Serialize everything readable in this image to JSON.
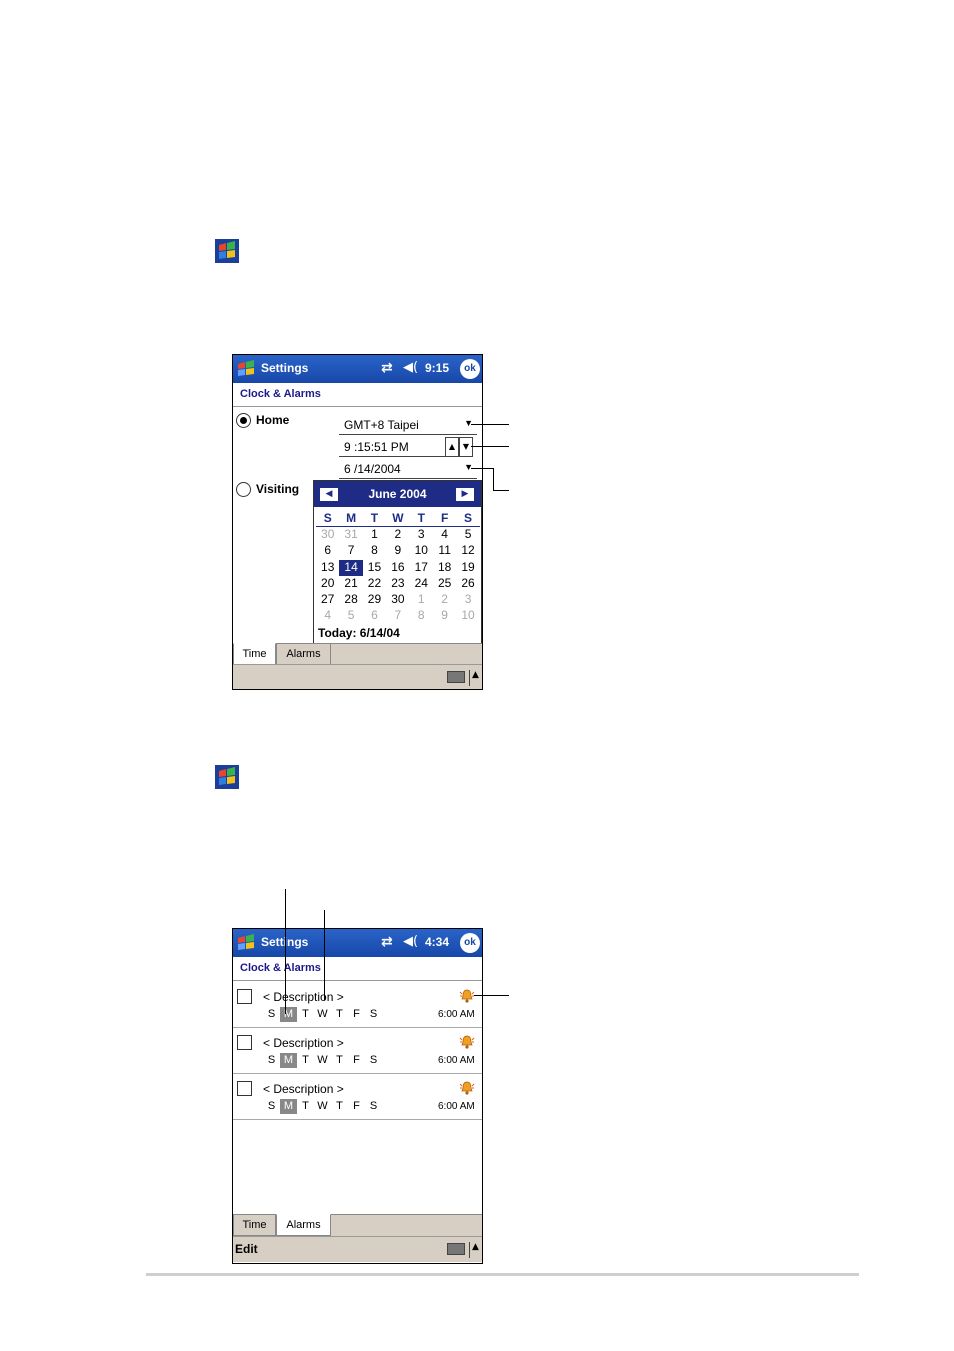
{
  "icon_names": [
    "windows-flag-icon",
    "connectivity-icon",
    "volume-icon",
    "ok-button",
    "keyboard-icon",
    "alarm-bell-icon"
  ],
  "colors": {
    "titlebar": "#1747a8",
    "calendar_header": "#1f2c85",
    "tab_bar": "#d8cfc4"
  },
  "screen1": {
    "titlebar": {
      "title": "Settings",
      "clock": "9:15",
      "ok": "ok",
      "conn_glyph": "⇄",
      "vol_glyph": "◀("
    },
    "app_header": "Clock & Alarms",
    "home_label": "Home",
    "visiting_label": "Visiting",
    "timezone": "GMT+8 Taipei",
    "time": "9 :15:51 PM",
    "date": "6 /14/2004",
    "calendar": {
      "month": "June 2004",
      "weekdays": [
        "S",
        "M",
        "T",
        "W",
        "T",
        "F",
        "S"
      ],
      "weeks": [
        [
          "30",
          "31",
          "1",
          "2",
          "3",
          "4",
          "5"
        ],
        [
          "6",
          "7",
          "8",
          "9",
          "10",
          "11",
          "12"
        ],
        [
          "13",
          "14",
          "15",
          "16",
          "17",
          "18",
          "19"
        ],
        [
          "20",
          "21",
          "22",
          "23",
          "24",
          "25",
          "26"
        ],
        [
          "27",
          "28",
          "29",
          "30",
          "1",
          "2",
          "3"
        ],
        [
          "4",
          "5",
          "6",
          "7",
          "8",
          "9",
          "10"
        ]
      ],
      "selected": "14",
      "today": "Today: 6/14/04"
    },
    "tabs": [
      "Time",
      "Alarms"
    ]
  },
  "screen2": {
    "titlebar": {
      "title": "Settings",
      "clock": "4:34",
      "ok": "ok",
      "conn_glyph": "⇄",
      "vol_glyph": "◀("
    },
    "app_header": "Clock & Alarms",
    "alarms": [
      {
        "description": "< Description >",
        "days": [
          "S",
          "M",
          "T",
          "W",
          "T",
          "F",
          "S"
        ],
        "time": "6:00 AM"
      },
      {
        "description": "< Description >",
        "days": [
          "S",
          "M",
          "T",
          "W",
          "T",
          "F",
          "S"
        ],
        "time": "6:00 AM"
      },
      {
        "description": "< Description >",
        "days": [
          "S",
          "M",
          "T",
          "W",
          "T",
          "F",
          "S"
        ],
        "time": "6:00 AM"
      }
    ],
    "tabs": [
      "Time",
      "Alarms"
    ],
    "edit_label": "Edit"
  }
}
